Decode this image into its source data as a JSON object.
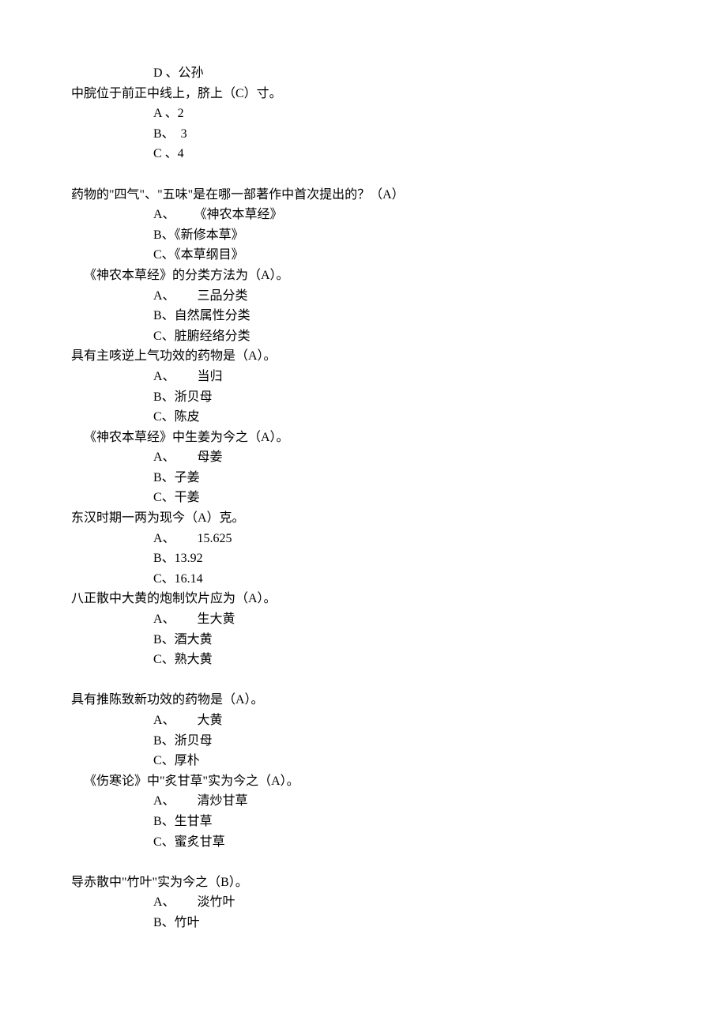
{
  "lines": [
    {
      "cls": "option",
      "text": "D 、公孙"
    },
    {
      "cls": "question",
      "text": "中脘位于前正中线上，脐上（C）寸。"
    },
    {
      "cls": "option",
      "text": "A 、2"
    },
    {
      "cls": "option",
      "text": "B、  3"
    },
    {
      "cls": "option",
      "text": "C 、4"
    },
    {
      "cls": "spacer",
      "text": ""
    },
    {
      "cls": "question",
      "text": "药物的\"四气\"、\"五味\"是在哪一部著作中首次提出的？（A）"
    },
    {
      "cls": "option-a-wide",
      "text": "A、      《神农本草经》"
    },
    {
      "cls": "option",
      "text": "B、《新修本草》"
    },
    {
      "cls": "option",
      "text": "C、《本草纲目》"
    },
    {
      "cls": "question-indent",
      "text": "《神农本草经》的分类方法为（A）。"
    },
    {
      "cls": "option-a-wide",
      "text": "A、       三品分类"
    },
    {
      "cls": "option",
      "text": "B、自然属性分类"
    },
    {
      "cls": "option",
      "text": "C、脏腑经络分类"
    },
    {
      "cls": "question",
      "text": "具有主咳逆上气功效的药物是（A）。"
    },
    {
      "cls": "option-a-wide",
      "text": "A、       当归"
    },
    {
      "cls": "option",
      "text": "B、浙贝母"
    },
    {
      "cls": "option",
      "text": "C、陈皮"
    },
    {
      "cls": "question-indent",
      "text": "《神农本草经》中生姜为今之（A）。"
    },
    {
      "cls": "option-a-wide",
      "text": "A、       母姜"
    },
    {
      "cls": "option",
      "text": "B、子姜"
    },
    {
      "cls": "option",
      "text": "C、干姜"
    },
    {
      "cls": "question",
      "text": "东汉时期一两为现今（A）克。"
    },
    {
      "cls": "option-a-wide",
      "text": "A、       15.625"
    },
    {
      "cls": "option",
      "text": "B、13.92"
    },
    {
      "cls": "option",
      "text": "C、16.14"
    },
    {
      "cls": "question",
      "text": "八正散中大黄的炮制饮片应为（A）。"
    },
    {
      "cls": "option-a-wide",
      "text": "A、       生大黄"
    },
    {
      "cls": "option",
      "text": "B、酒大黄"
    },
    {
      "cls": "option",
      "text": "C、熟大黄"
    },
    {
      "cls": "spacer",
      "text": ""
    },
    {
      "cls": "question",
      "text": "具有推陈致新功效的药物是（A）。"
    },
    {
      "cls": "option-a-wide",
      "text": "A、       大黄"
    },
    {
      "cls": "option",
      "text": "B、浙贝母"
    },
    {
      "cls": "option",
      "text": "C、厚朴"
    },
    {
      "cls": "question-indent",
      "text": "《伤寒论》中\"炙甘草\"实为今之（A）。"
    },
    {
      "cls": "option-a-wide",
      "text": "A、       清炒甘草"
    },
    {
      "cls": "option",
      "text": "B、生甘草"
    },
    {
      "cls": "option",
      "text": "C、蜜炙甘草"
    },
    {
      "cls": "spacer",
      "text": ""
    },
    {
      "cls": "question",
      "text": "导赤散中\"竹叶\"实为今之（B）。"
    },
    {
      "cls": "option-a-wide",
      "text": "A、       淡竹叶"
    },
    {
      "cls": "option",
      "text": "B、竹叶"
    }
  ]
}
